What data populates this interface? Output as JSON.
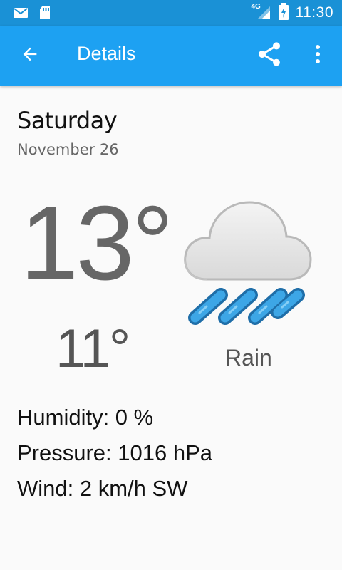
{
  "status_bar": {
    "network": "4G",
    "time": "11:30",
    "icons": [
      "mail-icon",
      "sd-card-icon",
      "signal-icon",
      "battery-charging-icon"
    ]
  },
  "app_bar": {
    "title": "Details",
    "back_icon": "arrow-back-icon",
    "share_icon": "share-icon",
    "overflow_icon": "more-vert-icon",
    "color": "#1da1f2"
  },
  "forecast": {
    "day": "Saturday",
    "date": "November 26",
    "high": "13°",
    "low": "11°",
    "condition": "Rain",
    "icon": "rain-cloud-icon"
  },
  "details": {
    "humidity": "Humidity: 0 %",
    "pressure": "Pressure: 1016 hPa",
    "wind": "Wind: 2 km/h SW"
  }
}
